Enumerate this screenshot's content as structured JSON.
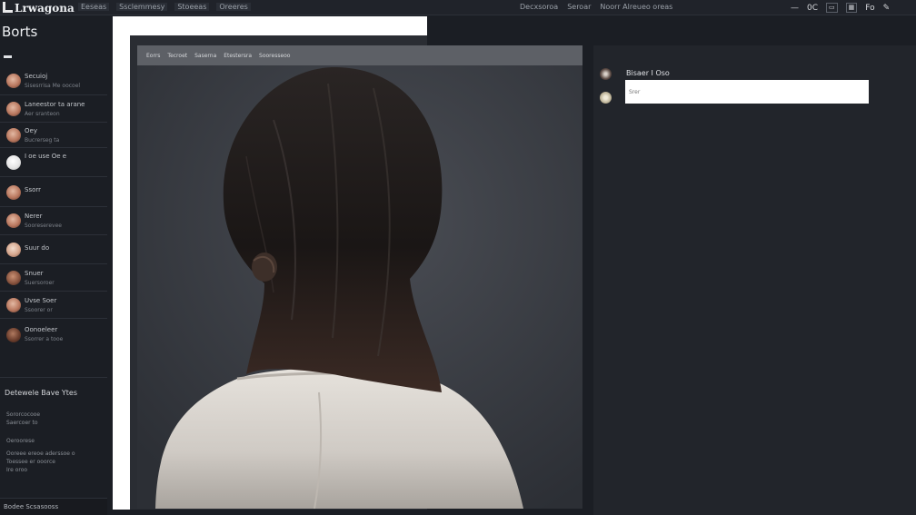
{
  "app": {
    "logo_text": "Lrwagona"
  },
  "topbar": {
    "nav_left": [
      "Eeseas",
      "Ssclemmesy",
      "Stoeeas",
      "Oreeres"
    ],
    "nav_right": [
      "Decxsoroa",
      "Seroar",
      "Noorr Alreueo oreas"
    ],
    "tray": {
      "t1": "—",
      "t2": "0C",
      "t3": "Fo"
    }
  },
  "page": {
    "title": "Borts"
  },
  "sidebar": {
    "conversations": [
      {
        "name": "Secuioj",
        "sub": "Sisesrrisa Me oocoel"
      },
      {
        "name": "Laneestor ta arane",
        "sub": "Aer sranteon"
      },
      {
        "name": "Oey",
        "sub": "Bucrerseg ta"
      },
      {
        "name": "I oe use Oe e",
        "sub": ""
      },
      {
        "name": "Ssorr",
        "sub": ""
      },
      {
        "name": "Nerer",
        "sub": "Sooreserevee"
      },
      {
        "name": "Suur do",
        "sub": ""
      },
      {
        "name": "Snuer",
        "sub": "Suersoroer"
      },
      {
        "name": "Uvse Soer",
        "sub": "Ssoorer or"
      },
      {
        "name": "Oonoeleer",
        "sub": "Ssorrer a tooe"
      }
    ],
    "section": {
      "title": "Detewele Bave Ytes",
      "lines": [
        "Sororcocooe",
        "Saercoer to",
        "Oeroorese",
        "Ooreee ereoe aderssoe o",
        "Toessee er ooorce",
        "Ire oroo"
      ]
    },
    "footer": "Bodee Scsasooss"
  },
  "image_panel": {
    "tabs": [
      "Eorrs",
      "Tecroet",
      "Saserna",
      "Etestersra",
      "Sooresseoo"
    ]
  },
  "right_panel": {
    "label": "Bisaer I Oso",
    "input_placeholder": "Srer"
  },
  "colors": {
    "background": "#1b1e24",
    "panel": "#22252b",
    "canvas_frame": "#ffffff",
    "tab_bar": "#5d6066"
  }
}
